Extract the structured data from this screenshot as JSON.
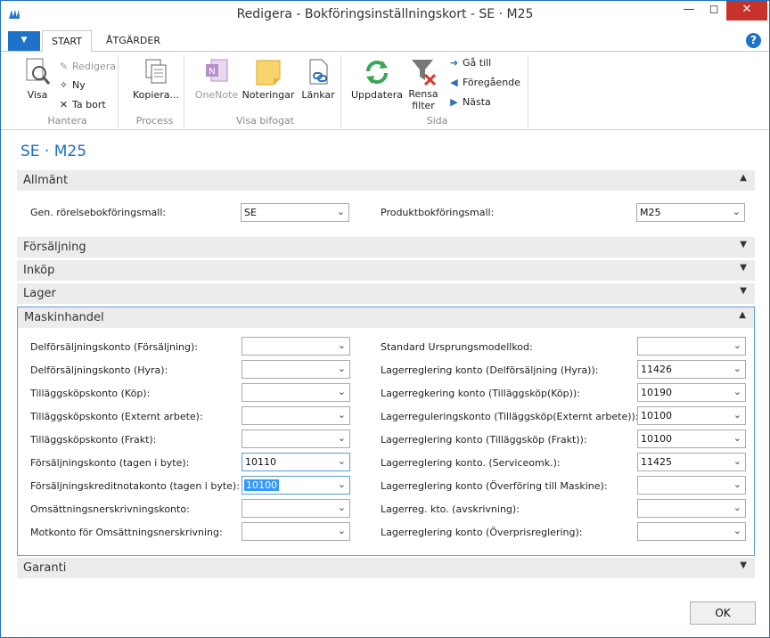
{
  "window": {
    "title": "Redigera - Bokföringsinställningskort - SE · M25"
  },
  "tabs": [
    "START",
    "ÅTGÄRDER"
  ],
  "ribbon": {
    "hantera": {
      "label": "Hantera",
      "visa": "Visa",
      "redigera": "Redigera",
      "ny": "Ny",
      "ta_bort": "Ta bort"
    },
    "process": {
      "label": "Process",
      "kopiera": "Kopiera..."
    },
    "visa_bifogat": {
      "label": "Visa bifogat",
      "onenote": "OneNote",
      "noteringar": "Noteringar",
      "lankar": "Länkar"
    },
    "sida": {
      "label": "Sida",
      "uppdatera": "Uppdatera",
      "rensa_1": "Rensa",
      "rensa_2": "filter",
      "ga_till": "Gå till",
      "foregaende": "Föregående",
      "nasta": "Nästa"
    }
  },
  "page_title": "SE · M25",
  "sections": {
    "allmant": {
      "title": "Allmänt",
      "gen_label": "Gen. rörelsebokföringsmall:",
      "gen_value": "SE",
      "prod_label": "Produktbokföringsmall:",
      "prod_value": "M25"
    },
    "forsaljning": "Försäljning",
    "inkop": "Inköp",
    "lager": "Lager",
    "maskinhandel": {
      "title": "Maskinhandel",
      "left": [
        {
          "label": "Delförsäljningskonto (Försäljning):",
          "value": ""
        },
        {
          "label": "Delförsäljningskonto (Hyra):",
          "value": ""
        },
        {
          "label": "Tilläggsköpskonto (Köp):",
          "value": ""
        },
        {
          "label": "Tilläggsköpskonto (Externt arbete):",
          "value": ""
        },
        {
          "label": "Tilläggsköpskonto (Frakt):",
          "value": ""
        },
        {
          "label": "Försäljningskonto (tagen i byte):",
          "value": "10110"
        },
        {
          "label": "Försäljningskreditnotakonto (tagen i byte):",
          "value": "10100"
        },
        {
          "label": "Omsättningsnerskrivningskonto:",
          "value": ""
        },
        {
          "label": "Motkonto för Omsättningsnerskrivning:",
          "value": ""
        }
      ],
      "right": [
        {
          "label": "Standard Ursprungsmodellkod:",
          "value": ""
        },
        {
          "label": "Lagerreglering konto  (Delförsäljning (Hyra)):",
          "value": "11426"
        },
        {
          "label": "Lagerregkering konto (Tilläggsköp(Köp)):",
          "value": "10190"
        },
        {
          "label": "Lagerreguleringskonto (Tilläggsköp(Externt arbete)):",
          "value": "10100"
        },
        {
          "label": "Lagerreglering konto (Tilläggsköp (Frakt)):",
          "value": "10100"
        },
        {
          "label": "Lagerreglering konto. (Serviceomk.):",
          "value": "11425"
        },
        {
          "label": "Lagerreglering konto  (Överföring till Maskine):",
          "value": ""
        },
        {
          "label": "Lagerreg. kto. (avskrivning):",
          "value": ""
        },
        {
          "label": "Lagerreglering konto (Överprisreglering):",
          "value": ""
        }
      ]
    },
    "garanti": "Garanti"
  },
  "ok_label": "OK",
  "colors": {
    "accent": "#1e73c9",
    "close": "#c7322b",
    "section_bg": "#ececec",
    "focus": "#5b9bd5"
  }
}
